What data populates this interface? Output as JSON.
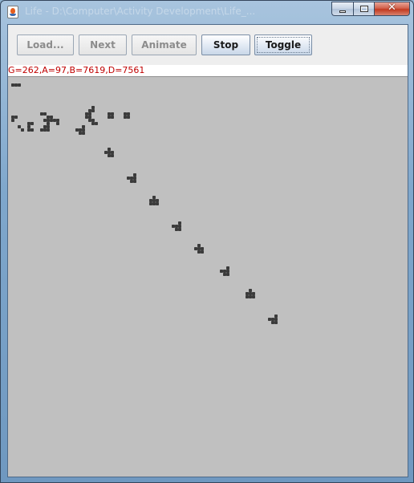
{
  "window": {
    "title": "Life - D:\\Computer\\Activity Development\\Life_..."
  },
  "toolbar": {
    "buttons": [
      {
        "id": "load",
        "label": "Load...",
        "enabled": false
      },
      {
        "id": "next",
        "label": "Next",
        "enabled": false
      },
      {
        "id": "animate",
        "label": "Animate",
        "enabled": false
      },
      {
        "id": "stop",
        "label": "Stop",
        "enabled": true
      },
      {
        "id": "toggle",
        "label": "Toggle",
        "enabled": true
      }
    ]
  },
  "status": {
    "text": "G=262,A=97,B=7619,D=7561"
  },
  "colors": {
    "cell_fill": "#3a3a3a",
    "cell_border": "#111111",
    "board_background": "#c0c0c0",
    "status_text": "#c00000"
  },
  "board": {
    "cell_size_px": 4,
    "live_cells": [
      [
        1,
        2
      ],
      [
        2,
        2
      ],
      [
        3,
        2
      ],
      [
        1,
        12
      ],
      [
        2,
        12
      ],
      [
        1,
        13
      ],
      [
        6,
        14
      ],
      [
        7,
        14
      ],
      [
        3,
        15
      ],
      [
        4,
        16
      ],
      [
        6,
        16
      ],
      [
        7,
        16
      ],
      [
        6,
        15
      ],
      [
        10,
        11
      ],
      [
        11,
        11
      ],
      [
        12,
        12
      ],
      [
        13,
        12
      ],
      [
        11,
        13
      ],
      [
        12,
        13
      ],
      [
        13,
        13
      ],
      [
        12,
        14
      ],
      [
        14,
        13
      ],
      [
        15,
        13
      ],
      [
        12,
        15
      ],
      [
        15,
        14
      ],
      [
        11,
        16
      ],
      [
        12,
        16
      ],
      [
        11,
        15
      ],
      [
        10,
        16
      ],
      [
        26,
        9
      ],
      [
        25,
        10
      ],
      [
        26,
        10
      ],
      [
        24,
        11
      ],
      [
        25,
        11
      ],
      [
        24,
        12
      ],
      [
        25,
        12
      ],
      [
        25,
        13
      ],
      [
        26,
        13
      ],
      [
        26,
        14
      ],
      [
        27,
        14
      ],
      [
        21,
        16
      ],
      [
        22,
        16
      ],
      [
        23,
        16
      ],
      [
        23,
        15
      ],
      [
        22,
        17
      ],
      [
        23,
        17
      ],
      [
        31,
        11
      ],
      [
        32,
        11
      ],
      [
        31,
        12
      ],
      [
        32,
        12
      ],
      [
        36,
        11
      ],
      [
        37,
        11
      ],
      [
        36,
        12
      ],
      [
        37,
        12
      ],
      [
        30,
        23
      ],
      [
        31,
        23
      ],
      [
        32,
        23
      ],
      [
        31,
        22
      ],
      [
        32,
        24
      ],
      [
        31,
        24
      ],
      [
        37,
        31
      ],
      [
        38,
        31
      ],
      [
        39,
        31
      ],
      [
        39,
        30
      ],
      [
        38,
        32
      ],
      [
        39,
        32
      ],
      [
        44,
        38
      ],
      [
        45,
        38
      ],
      [
        46,
        38
      ],
      [
        45,
        37
      ],
      [
        44,
        39
      ],
      [
        45,
        39
      ],
      [
        46,
        39
      ],
      [
        51,
        46
      ],
      [
        52,
        46
      ],
      [
        53,
        46
      ],
      [
        53,
        45
      ],
      [
        52,
        47
      ],
      [
        53,
        47
      ],
      [
        58,
        53
      ],
      [
        59,
        53
      ],
      [
        60,
        53
      ],
      [
        59,
        52
      ],
      [
        59,
        54
      ],
      [
        60,
        54
      ],
      [
        66,
        60
      ],
      [
        67,
        60
      ],
      [
        68,
        60
      ],
      [
        68,
        59
      ],
      [
        67,
        61
      ],
      [
        68,
        61
      ],
      [
        74,
        67
      ],
      [
        75,
        67
      ],
      [
        76,
        67
      ],
      [
        75,
        66
      ],
      [
        74,
        68
      ],
      [
        75,
        68
      ],
      [
        76,
        68
      ],
      [
        81,
        75
      ],
      [
        82,
        75
      ],
      [
        83,
        75
      ],
      [
        83,
        74
      ],
      [
        82,
        76
      ],
      [
        83,
        76
      ]
    ]
  }
}
